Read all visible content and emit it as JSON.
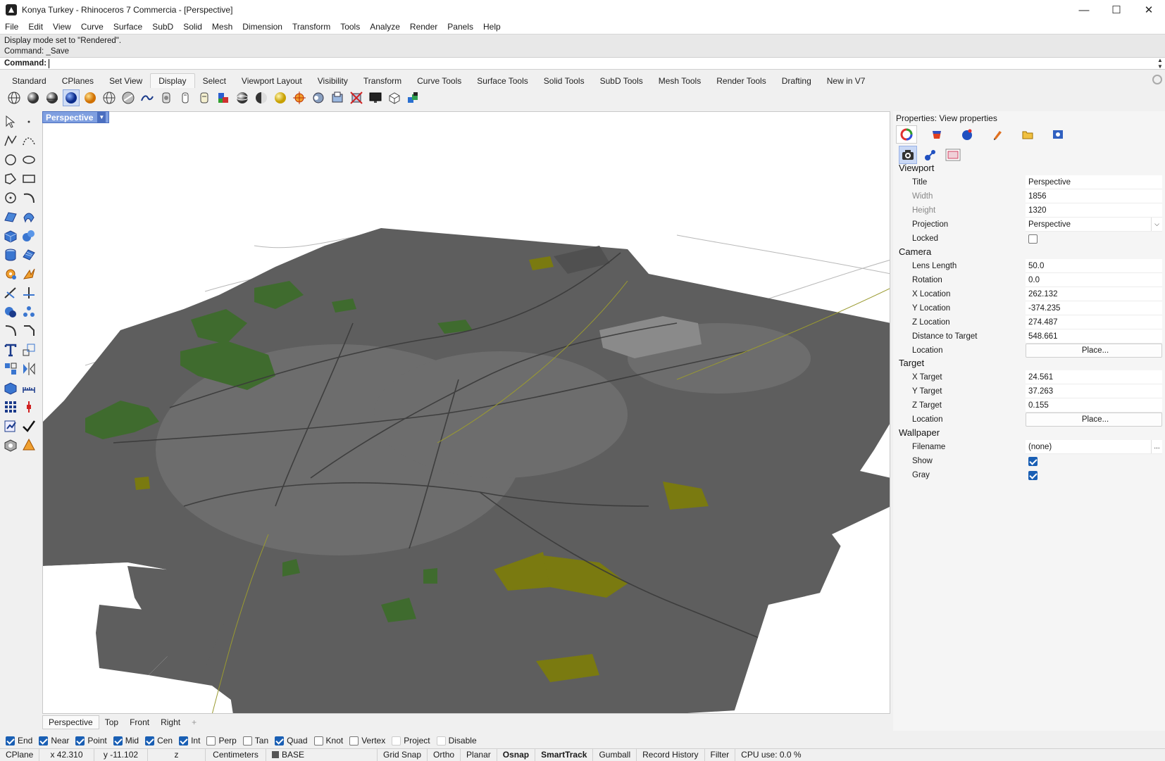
{
  "window": {
    "title": "Konya Turkey - Rhinoceros 7 Commercia - [Perspective]",
    "minimize": "—",
    "maximize": "☐",
    "close": "✕"
  },
  "menu": [
    "File",
    "Edit",
    "View",
    "Curve",
    "Surface",
    "SubD",
    "Solid",
    "Mesh",
    "Dimension",
    "Transform",
    "Tools",
    "Analyze",
    "Render",
    "Panels",
    "Help"
  ],
  "command_history": [
    "Display mode set to \"Rendered\".",
    "Command: _Save"
  ],
  "command_prompt": "Command:",
  "toolbar_tabs": [
    "Standard",
    "CPlanes",
    "Set View",
    "Display",
    "Select",
    "Viewport Layout",
    "Visibility",
    "Transform",
    "Curve Tools",
    "Surface Tools",
    "Solid Tools",
    "SubD Tools",
    "Mesh Tools",
    "Render Tools",
    "Drafting",
    "New in V7"
  ],
  "active_toolbar_tab": "Display",
  "display_toolbar_icons": [
    "wireframe-icon",
    "shaded-icon",
    "rendered-icon",
    "ghosted-icon",
    "xray-icon",
    "technical-icon",
    "artistic-icon",
    "pen-icon",
    "arctic-icon",
    "raytraced-icon",
    "monochrome-icon",
    "pen-display-icon",
    "shaded-sphere-icon",
    "gold-sphere-icon",
    "shaded-globe-icon",
    "crosshair-icon",
    "sphere-settings-icon",
    "clipping-icon",
    "cross-section-icon",
    "screen-icon",
    "box-icon",
    "layers-cubes-icon"
  ],
  "viewport": {
    "label": "Perspective",
    "tabs": [
      "Perspective",
      "Top",
      "Front",
      "Right"
    ],
    "add_tab": "+"
  },
  "properties": {
    "title": "Properties: View properties",
    "tab_icons": [
      "color-wheel-icon",
      "material-icon",
      "environment-icon",
      "brush-icon",
      "folder-icon",
      "help-icon"
    ],
    "sub_icons": [
      "camera-icon",
      "light-icon",
      "wallpaper-icon"
    ],
    "viewport_section": "Viewport",
    "viewport": {
      "title_label": "Title",
      "title_value": "Perspective",
      "width_label": "Width",
      "width_value": "1856",
      "height_label": "Height",
      "height_value": "1320",
      "projection_label": "Projection",
      "projection_value": "Perspective",
      "locked_label": "Locked",
      "locked": false
    },
    "camera_section": "Camera",
    "camera": {
      "lens_label": "Lens Length",
      "lens_value": "50.0",
      "rotation_label": "Rotation",
      "rotation_value": "0.0",
      "xloc_label": "X Location",
      "xloc_value": "262.132",
      "yloc_label": "Y Location",
      "yloc_value": "-374.235",
      "zloc_label": "Z Location",
      "zloc_value": "274.487",
      "dist_label": "Distance to Target",
      "dist_value": "548.661",
      "location_label": "Location",
      "location_button": "Place..."
    },
    "target_section": "Target",
    "target": {
      "x_label": "X Target",
      "x_value": "24.561",
      "y_label": "Y Target",
      "y_value": "37.263",
      "z_label": "Z Target",
      "z_value": "0.155",
      "location_label": "Location",
      "location_button": "Place..."
    },
    "wallpaper_section": "Wallpaper",
    "wallpaper": {
      "filename_label": "Filename",
      "filename_value": "(none)",
      "filename_button": "...",
      "show_label": "Show",
      "show": true,
      "gray_label": "Gray",
      "gray": true
    }
  },
  "osnaps": [
    {
      "label": "End",
      "on": true
    },
    {
      "label": "Near",
      "on": true
    },
    {
      "label": "Point",
      "on": true
    },
    {
      "label": "Mid",
      "on": true
    },
    {
      "label": "Cen",
      "on": true
    },
    {
      "label": "Int",
      "on": true
    },
    {
      "label": "Perp",
      "on": false
    },
    {
      "label": "Tan",
      "on": false
    },
    {
      "label": "Quad",
      "on": true
    },
    {
      "label": "Knot",
      "on": false
    },
    {
      "label": "Vertex",
      "on": false
    },
    {
      "label": "Project",
      "on": false
    },
    {
      "label": "Disable",
      "on": false
    }
  ],
  "status": {
    "cplane": "CPlane",
    "x": "x 42.310",
    "y": "y -11.102",
    "z": "z",
    "units": "Centimeters",
    "layer": "BASE",
    "grid_snap": "Grid Snap",
    "ortho": "Ortho",
    "planar": "Planar",
    "osnap": "Osnap",
    "smarttrack": "SmartTrack",
    "gumball": "Gumball",
    "record_history": "Record History",
    "filter": "Filter",
    "cpu": "CPU use: 0.0 %"
  },
  "colors": {
    "map_gray": "#5e5e5e",
    "park_green": "#3f6b2e",
    "field_olive": "#7a7a10",
    "viewport_label": "#7f9fe0",
    "checkbox_blue": "#1a5fb4"
  }
}
